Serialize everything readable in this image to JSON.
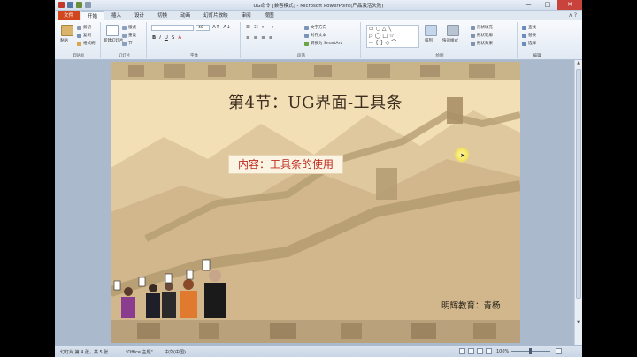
{
  "window": {
    "title": "UG命令 [兼容模式] - Microsoft PowerPoint(产品激活失败)",
    "controls": {
      "minimize": "—",
      "maximize": "□",
      "close": "✕"
    }
  },
  "tabs": [
    "文件",
    "开始",
    "插入",
    "设计",
    "切换",
    "动画",
    "幻灯片放映",
    "审阅",
    "视图"
  ],
  "active_tab": "开始",
  "ribbon": {
    "clipboard": {
      "paste": "粘贴",
      "cut": "剪切",
      "copy": "复制",
      "format_painter": "格式刷",
      "label": "剪贴板"
    },
    "slides": {
      "new_slide": "新建幻灯片",
      "layout": "版式",
      "reset": "重设",
      "section": "节",
      "label": "幻灯片"
    },
    "font": {
      "font_name": "",
      "font_size": "40",
      "label": "字体",
      "bold": "B",
      "italic": "I",
      "underline": "U",
      "strike": "S"
    },
    "paragraph": {
      "text_direction": "文字方向",
      "align_text": "对齐文本",
      "smartart": "转换为 SmartArt",
      "label": "段落"
    },
    "drawing": {
      "arrange": "排列",
      "quick_styles": "快速样式",
      "fill": "形状填充",
      "outline": "形状轮廓",
      "effects": "形状效果",
      "label": "绘图"
    },
    "editing": {
      "find": "查找",
      "replace": "替换",
      "select": "选择",
      "label": "编辑"
    }
  },
  "slide": {
    "title": "第4节：UG界面-工具条",
    "content": "内容：工具条的使用",
    "author": "明辉教育：青杨"
  },
  "statusbar": {
    "slide_info": "幻灯片 第 4 张，共 5 张",
    "theme": "\"Office 主题\"",
    "language": "中文(中国)",
    "zoom": "100%"
  },
  "colors": {
    "file_tab": "#d2461d",
    "slide_bg": "#f2dfb6",
    "title_text": "#3c2d1f",
    "content_text": "#c0291e",
    "close_button": "#c7433b"
  }
}
